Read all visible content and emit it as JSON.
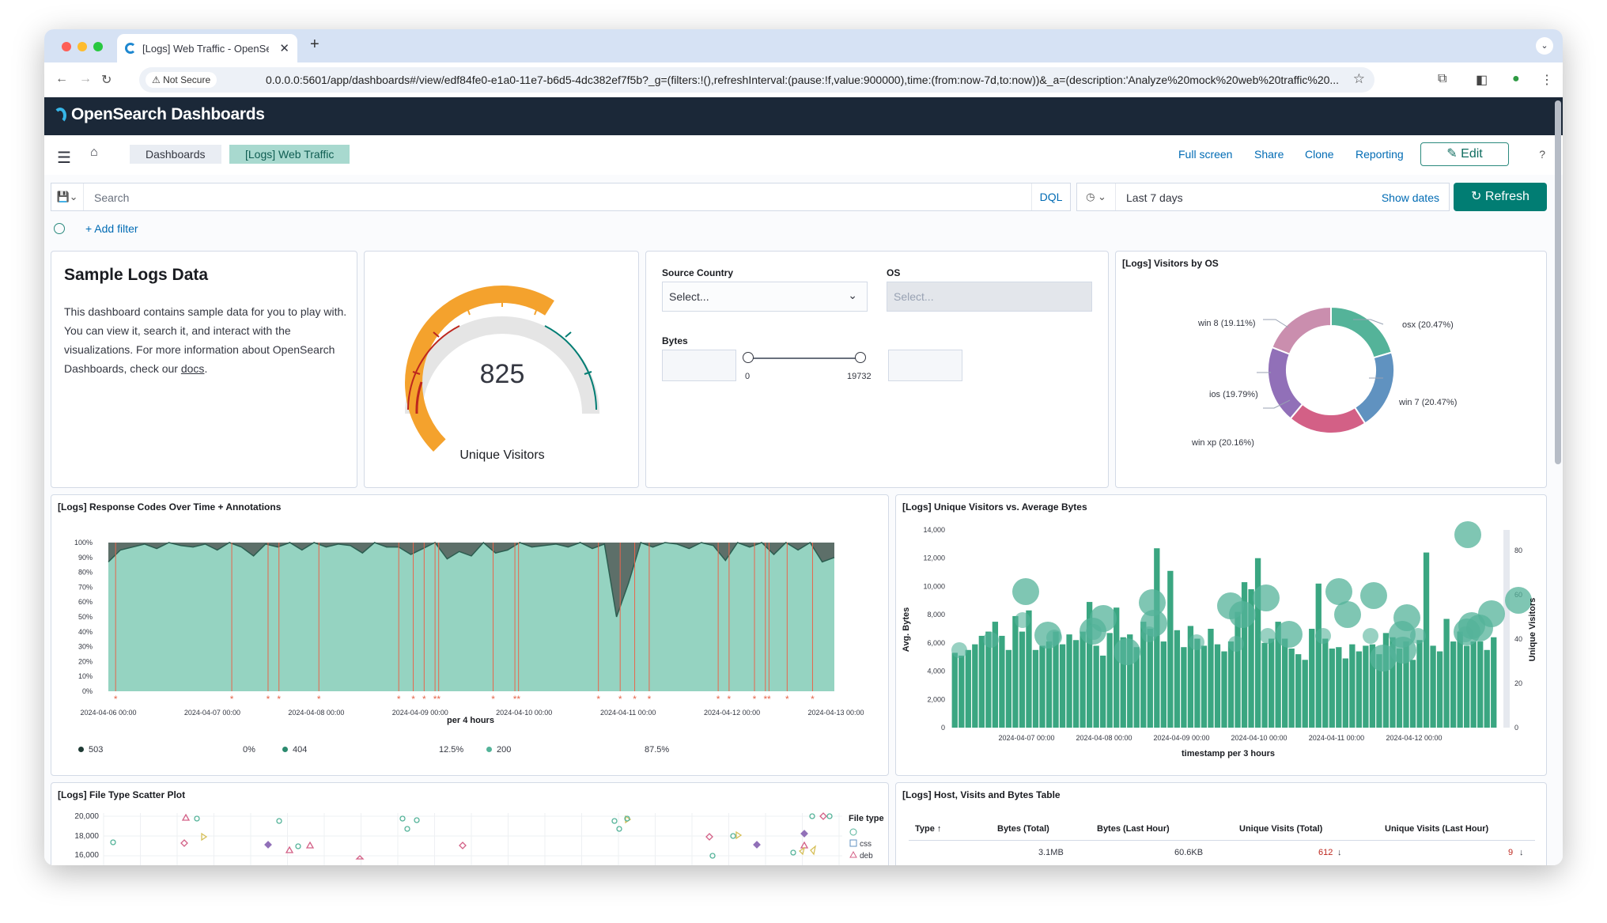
{
  "browser": {
    "tab_title": "[Logs] Web Traffic - OpenSearch Dashboards",
    "security_label": "Not Secure",
    "url": "0.0.0.0:5601/app/dashboards#/view/edf84fe0-e1a0-11e7-b6d5-4dc382ef7f5b?_g=(filters:!(),refreshInterval:(pause:!f,value:900000),time:(from:now-7d,to:now))&_a=(description:'Analyze%20mock%20web%20traffic%20..."
  },
  "app": {
    "logo_text": "OpenSearch Dashboards",
    "breadcrumbs": [
      "Dashboards",
      "[Logs] Web Traffic"
    ],
    "nav_links": {
      "full_screen": "Full screen",
      "share": "Share",
      "clone": "Clone",
      "reporting": "Reporting"
    },
    "edit_label": "Edit"
  },
  "query_bar": {
    "search_placeholder": "Search",
    "language": "DQL",
    "time_range": "Last 7 days",
    "show_dates": "Show dates",
    "refresh_label": "Refresh",
    "add_filter": "+ Add filter"
  },
  "markdown_panel": {
    "title": "Sample Logs Data",
    "body_text": "This dashboard contains sample data for you to play with. You can view it, search it, and interact with the visualizations. For more information about OpenSearch Dashboards, check our ",
    "link_text": "docs",
    "body_end": "."
  },
  "gauge_panel": {
    "value": "825",
    "label": "Unique Visitors",
    "fraction": 0.62
  },
  "controls_panel": {
    "source_country_label": "Source Country",
    "source_country_placeholder": "Select...",
    "os_label": "OS",
    "os_placeholder": "Select...",
    "bytes_label": "Bytes",
    "bytes_min": "0",
    "bytes_max": "19732"
  },
  "os_panel": {
    "title": "[Logs] Visitors by OS",
    "slice_labels": {
      "osx": "osx (20.47%)",
      "win7": "win 7 (20.47%)",
      "winxp": "win xp (20.16%)",
      "ios": "ios (19.79%)",
      "win8": "win 8 (19.11%)"
    }
  },
  "response_panel": {
    "title": "[Logs] Response Codes Over Time + Annotations",
    "y_ticks": [
      "100%",
      "90%",
      "80%",
      "70%",
      "60%",
      "50%",
      "40%",
      "30%",
      "20%",
      "10%",
      "0%"
    ],
    "x_ticks": [
      "2024-04-06 00:00",
      "2024-04-07 00:00",
      "2024-04-08 00:00",
      "2024-04-09 00:00",
      "2024-04-10 00:00",
      "2024-04-11 00:00",
      "2024-04-12 00:00",
      "2024-04-13 00:00"
    ],
    "x_title": "per 4 hours",
    "legend": [
      {
        "name": "503",
        "pct": "0%",
        "color": "#1e3a34"
      },
      {
        "name": "404",
        "pct": "12.5%",
        "color": "#2b8a6e"
      },
      {
        "name": "200",
        "pct": "87.5%",
        "color": "#54b399"
      }
    ]
  },
  "visitors_panel": {
    "title": "[Logs] Unique Visitors vs. Average Bytes",
    "y_left_ticks": [
      "14,000",
      "12,000",
      "10,000",
      "8,000",
      "6,000",
      "4,000",
      "2,000",
      "0"
    ],
    "y_right_ticks": [
      "80",
      "60",
      "40",
      "20",
      "0"
    ],
    "y_left_title": "Avg. Bytes",
    "y_right_title": "Unique Visitors",
    "x_ticks": [
      "2024-04-07 00:00",
      "2024-04-08 00:00",
      "2024-04-09 00:00",
      "2024-04-10 00:00",
      "2024-04-11 00:00",
      "2024-04-12 00:00"
    ],
    "x_title": "timestamp per 3 hours"
  },
  "scatter_panel": {
    "title": "[Logs] File Type Scatter Plot",
    "y_ticks": [
      "20,000",
      "18,000",
      "16,000"
    ],
    "legend_title": "File type",
    "legend_items": [
      "css",
      "deb"
    ]
  },
  "table_panel": {
    "title": "[Logs] Host, Visits and Bytes Table",
    "headers": [
      "Type ↑",
      "Bytes (Total)",
      "Bytes (Last Hour)",
      "Unique Visits (Total)",
      "Unique Visits (Last Hour)"
    ],
    "row": [
      "",
      "3.1MB",
      "60.6KB",
      "612",
      "9"
    ]
  },
  "chart_data": [
    {
      "type": "area",
      "title": "[Logs] Response Codes Over Time + Annotations",
      "xlabel": "per 4 hours",
      "ylim": [
        0,
        100
      ],
      "series": [
        {
          "name": "200",
          "values": [
            87,
            95,
            97,
            99,
            96,
            100,
            98,
            97,
            99,
            95,
            100,
            97,
            91,
            99,
            97,
            100,
            95,
            100,
            97,
            99,
            98,
            93,
            100,
            97,
            97,
            92,
            96,
            100,
            89,
            94,
            91,
            100,
            93,
            95,
            100,
            97,
            98,
            99,
            97,
            100,
            96,
            99,
            50,
            73,
            100,
            97,
            100,
            99,
            96,
            100,
            98,
            88,
            100,
            97,
            100,
            92,
            100,
            95,
            100,
            87,
            90
          ]
        },
        {
          "name": "404",
          "values": [
            13,
            5,
            3,
            1,
            4,
            0,
            2,
            3,
            1,
            5,
            0,
            3,
            9,
            1,
            3,
            0,
            5,
            0,
            3,
            1,
            2,
            7,
            0,
            3,
            3,
            8,
            4,
            0,
            11,
            6,
            9,
            0,
            7,
            5,
            0,
            3,
            2,
            1,
            3,
            0,
            4,
            1,
            50,
            27,
            0,
            3,
            0,
            1,
            4,
            0,
            2,
            12,
            0,
            3,
            0,
            8,
            0,
            5,
            0,
            13,
            10
          ]
        },
        {
          "name": "503",
          "values": [
            0,
            0,
            0,
            0,
            0,
            0,
            0,
            0,
            0,
            0,
            0,
            0,
            0,
            0,
            0,
            0,
            0,
            0,
            0,
            0,
            0,
            0,
            0,
            0,
            0,
            0,
            0,
            0,
            0,
            0,
            0,
            0,
            0,
            0,
            0,
            0,
            0,
            0,
            0,
            0,
            0,
            0,
            0,
            0,
            0,
            0,
            0,
            0,
            0,
            0,
            0,
            0,
            0,
            0,
            0,
            0,
            0,
            0,
            0,
            0,
            0
          ]
        }
      ]
    },
    {
      "type": "bar",
      "title": "[Logs] Unique Visitors vs. Average Bytes",
      "xlabel": "timestamp per 3 hours",
      "ylabel": "Avg. Bytes",
      "ylim": [
        0,
        14000
      ],
      "series": [
        {
          "name": "Avg. Bytes",
          "values": [
            5300,
            5100,
            5500,
            5900,
            6500,
            6800,
            7500,
            6500,
            5500,
            7900,
            6800,
            8300,
            5500,
            5800,
            6100,
            6800,
            5900,
            6600,
            6200,
            6800,
            8900,
            5800,
            5100,
            6700,
            8500,
            6400,
            6600,
            5700,
            7500,
            7000,
            12700,
            6100,
            11100,
            6900,
            5700,
            7200,
            6300,
            5800,
            7000,
            5900,
            5400,
            6100,
            8200,
            10300,
            9800,
            12000,
            6000,
            6300,
            7500,
            6300,
            5600,
            5200,
            4800,
            7000,
            10200,
            6300,
            5600,
            5700,
            4900,
            5900,
            5400,
            5800,
            5900,
            5200,
            6700,
            6400,
            5600,
            6100,
            4800,
            6200,
            12400,
            5800,
            5400,
            7700,
            6100,
            6800,
            5800,
            6100,
            6100,
            5500,
            6400
          ]
        },
        {
          "name": "Unique Visitors",
          "values": []
        }
      ]
    }
  ]
}
